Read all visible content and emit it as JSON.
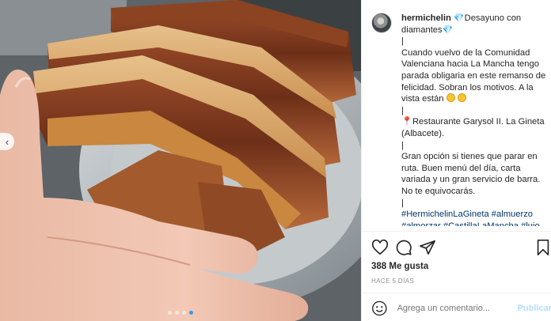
{
  "post": {
    "username": "hermichelin",
    "caption_lines": [
      "Desayuno con diamantes",
      "|",
      "Cuando vuelvo de la Comunidad Valenciana hacia La Mancha tengo parada obligaria en este remanso de felicidad. Sobran los motivos. A la vista están",
      "|",
      "Restaurante Garysol II. La Gineta (Albacete).",
      "|",
      "Gran opción si tienes que parar en ruta. Buen menú del día, carta variada y un gran servicio de barra. No te equivocarás.",
      "|",
      "#HermichelinLaGineta #almuerzo #almorzar #CastillaLaMancha #lujo #torreznos #cerdo #restaurante"
    ],
    "likes": "388 Me gusta",
    "time": "HACE 5 DÍAS"
  },
  "comment": {
    "placeholder": "Agrega un comentario...",
    "publish_label": "Publicar"
  },
  "carousel": {
    "total": 4,
    "active_index": 3
  },
  "icons": {
    "like": "heart-icon",
    "comment": "comment-icon",
    "share": "share-icon",
    "save": "bookmark-icon",
    "emoji": "emoji-icon",
    "prev": "chevron-left-icon"
  },
  "colors": {
    "link": "#00376b",
    "accent": "#3897f0",
    "publish": "#b2dffc",
    "muted": "#8e8e8e"
  }
}
